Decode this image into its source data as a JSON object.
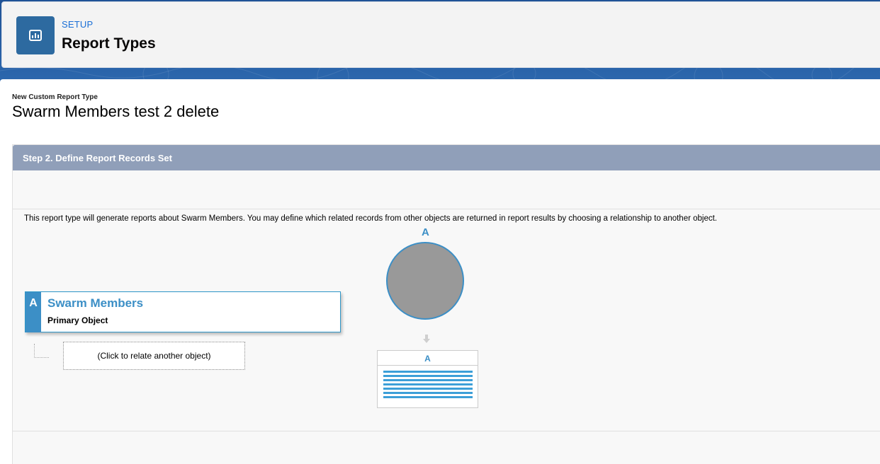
{
  "header": {
    "eyebrow": "SETUP",
    "title": "Report Types",
    "icon": "report-icon"
  },
  "page": {
    "label": "New Custom Report Type",
    "title": "Swarm Members test 2 delete"
  },
  "step": {
    "header": "Step 2. Define Report Records Set",
    "description": "This report type will generate reports about Swarm Members. You may define which related records from other objects are returned in report results by choosing a relationship to another object."
  },
  "object_tree": {
    "primary": {
      "badge": "A",
      "name": "Swarm Members",
      "subtitle": "Primary Object"
    },
    "relate_prompt": "(Click to relate another object)"
  },
  "venn": {
    "letter": "A",
    "result_letter": "A",
    "colors": {
      "circle_fill": "#999999",
      "circle_border": "#3c8fc6",
      "result_lines": "#3c9fd8"
    }
  },
  "colors": {
    "accent": "#3c8fc6",
    "step_header": "#909fb9",
    "brand_link": "#1b6fd6"
  }
}
